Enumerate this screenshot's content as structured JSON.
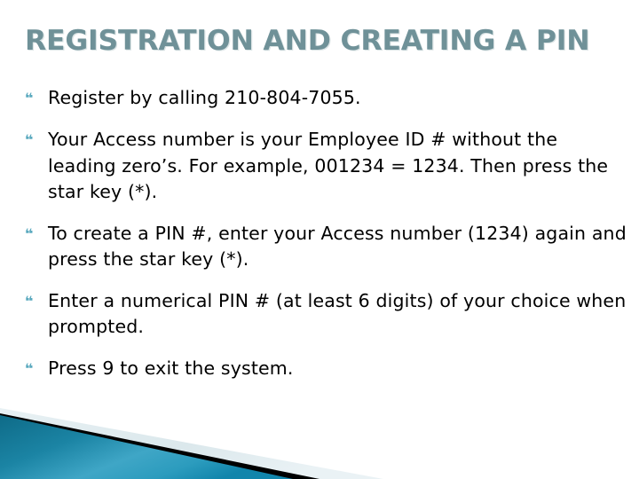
{
  "slide": {
    "title": "REGISTRATION AND CREATING A PIN",
    "bullet_glyph": "❝",
    "bullets": [
      {
        "text": "Register by calling 210-804-7055."
      },
      {
        "text": "Your Access number is your Employee ID # without the leading zero’s.  For example, 001234 = 1234. Then press the star key (*)."
      },
      {
        "text": "To create a PIN #, enter your Access number (1234) again and press the star key (*)."
      },
      {
        "text": "Enter a numerical PIN # (at least 6 digits) of your choice when prompted."
      },
      {
        "text": "Press 9 to exit the system."
      }
    ]
  },
  "theme": {
    "title_color": "#6F9198",
    "bullet_color": "#5AA9BE",
    "body_text_color": "#000000",
    "background_color": "#FFFFFF",
    "deco_teal_dark": "#10718F",
    "deco_teal_light": "#5EC0DE",
    "deco_black": "#000000",
    "deco_pale": "#DCE8EC"
  }
}
